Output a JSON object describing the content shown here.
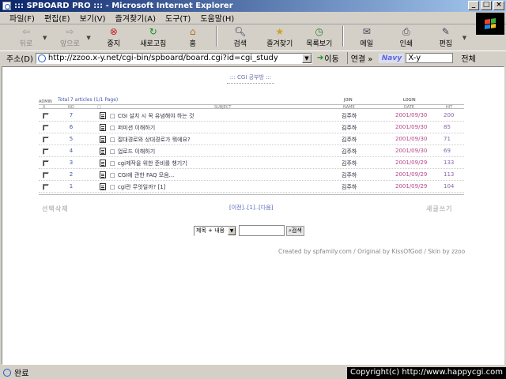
{
  "window": {
    "title": "::: SPBOARD PRO ::: - Microsoft Internet Explorer",
    "controls": [
      "_",
      "□",
      "×"
    ]
  },
  "menu": [
    "파일(F)",
    "편집(E)",
    "보기(V)",
    "즐겨찾기(A)",
    "도구(T)",
    "도움말(H)"
  ],
  "toolbar": {
    "back": "뒤로",
    "forward": "앞으로",
    "stop": "중지",
    "refresh": "새로고침",
    "home": "홈",
    "search": "검색",
    "favorites": "즐겨찾기",
    "history": "목록보기",
    "mail": "메일",
    "print": "인쇄",
    "edit": "편집"
  },
  "address": {
    "label": "주소(D)",
    "url": "http://zzoo.x-y.net/cgi-bin/spboard/board.cgi?id=cgi_study",
    "go": "이동",
    "links": "연결 »",
    "navy_logo": "Navy",
    "navy_query": "X-y",
    "navy_search": "전체"
  },
  "board": {
    "title": "::: CGI 공부방 :::",
    "admin": "ADMIN",
    "total": "Total 7 articles (1/1 Page)",
    "join": "JOIN",
    "login": "LOGIN",
    "headers": {
      "check": "X",
      "no": "NO",
      "subject": "SUBJECT",
      "name": "NAME",
      "date": "DATE",
      "hit": "HIT"
    },
    "rows": [
      {
        "no": "7",
        "subject": "CGI 설치 시 꼭 유념해야 하는 것",
        "name": "김주하",
        "date": "2001/09/30",
        "hit": "200"
      },
      {
        "no": "6",
        "subject": "퍼미션 이해하기",
        "name": "김주하",
        "date": "2001/09/30",
        "hit": "85"
      },
      {
        "no": "5",
        "subject": "절대경로와 상대경로가 뭐에요?",
        "name": "김주하",
        "date": "2001/09/30",
        "hit": "71"
      },
      {
        "no": "4",
        "subject": "업로드 이해하기",
        "name": "김주하",
        "date": "2001/09/30",
        "hit": "69"
      },
      {
        "no": "3",
        "subject": "cgi제작을 위한 준비를 챙기기",
        "name": "김주하",
        "date": "2001/09/29",
        "hit": "133"
      },
      {
        "no": "2",
        "subject": "CGI에 관한 FAQ 모음...",
        "name": "김주하",
        "date": "2001/09/29",
        "hit": "113"
      },
      {
        "no": "1",
        "subject": "cgi란 무엇일까? [1]",
        "name": "김주하",
        "date": "2001/09/29",
        "hit": "104"
      }
    ],
    "delete_label": "선택삭제",
    "write_label": "새글쓰기",
    "pager": "[이전]..[1]..[다음]",
    "search_option": "제목 + 내용",
    "search_button": "검색",
    "credit": "Created by spfamily.com / Original by KissOfGod / Skin by zzoo"
  },
  "status": {
    "text": "완료",
    "copyright": "Copyright(c) http://www.happycgi.com"
  }
}
